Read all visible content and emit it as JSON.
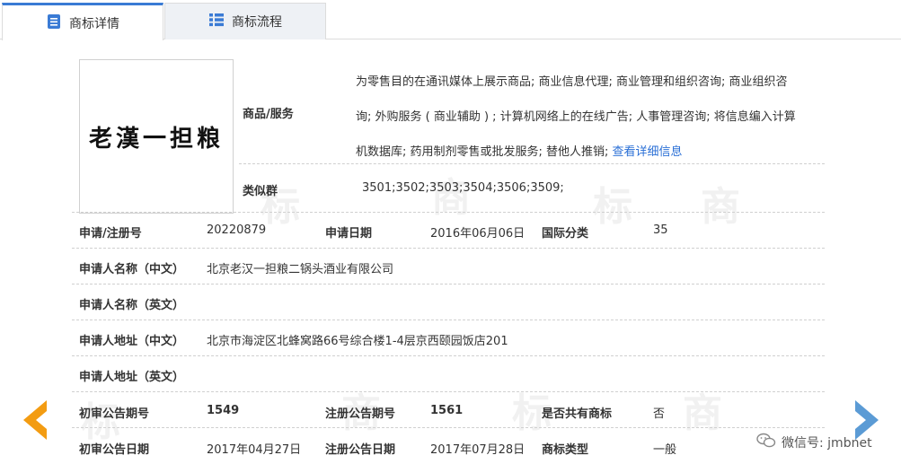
{
  "tabs": [
    {
      "label": "商标详情",
      "active": true,
      "icon": "document-icon"
    },
    {
      "label": "商标流程",
      "active": false,
      "icon": "list-icon"
    }
  ],
  "trademark": {
    "image_text": "老漢一担粮"
  },
  "goods": {
    "label": "商品/服务",
    "line1": "为零售目的在通讯媒体上展示商品; 商业信息代理; 商业管理和组织咨询; 商业组织咨",
    "line2": "询; 外购服务 ( 商业辅助 ) ; 计算机网络上的在线广告; 人事管理咨询; 将信息编入计算",
    "line3": "机数据库; 药用制剂零售或批发服务; 替他人推销;",
    "more_link": "查看详细信息"
  },
  "similar_group": {
    "label": "类似群",
    "value": "3501;3502;3503;3504;3506;3509;"
  },
  "rows": {
    "reg_no_label": "申请/注册号",
    "reg_no": "20220879",
    "apply_date_label": "申请日期",
    "apply_date": "2016年06月06日",
    "intl_class_label": "国际分类",
    "intl_class": "35",
    "applicant_cn_label": "申请人名称（中文）",
    "applicant_cn": "北京老汉一担粮二锅头酒业有限公司",
    "applicant_en_label": "申请人名称（英文）",
    "applicant_en": "",
    "address_cn_label": "申请人地址（中文）",
    "address_cn": "北京市海淀区北蜂窝路66号综合楼1-4层京西颐园饭店201",
    "address_en_label": "申请人地址（英文）",
    "address_en": "",
    "prelim_no_label": "初审公告期号",
    "prelim_no": "1549",
    "reg_pub_no_label": "注册公告期号",
    "reg_pub_no": "1561",
    "shared_label": "是否共有商标",
    "shared": "否",
    "prelim_date_label": "初审公告日期",
    "prelim_date": "2017年04月27日",
    "reg_pub_date_label": "注册公告日期",
    "reg_pub_date": "2017年07月28日",
    "tm_type_label": "商标类型",
    "tm_type": "一般"
  },
  "nav": {
    "prev_icon": "chevron-left-icon",
    "next_icon": "chevron-right-icon",
    "prev_color": "#f39c12",
    "next_color": "#5b9bd5"
  },
  "watermark_badge": {
    "text": "微信号: jmbnet",
    "icon": "wechat-icon"
  }
}
